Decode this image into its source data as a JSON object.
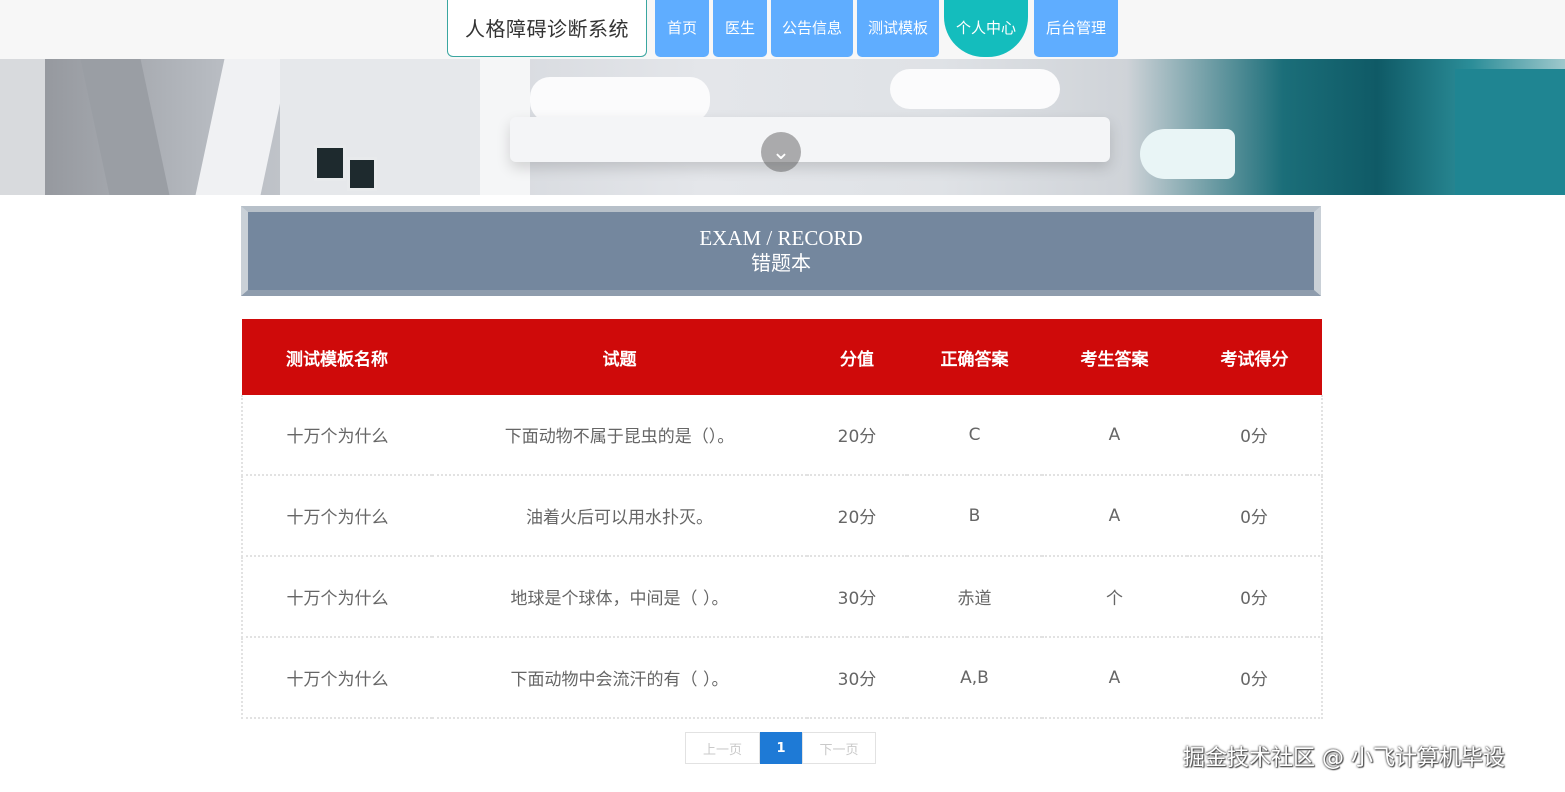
{
  "nav": {
    "site_title": "人格障碍诊断系统",
    "items": [
      {
        "label": "首页",
        "active": false
      },
      {
        "label": "医生",
        "active": false
      },
      {
        "label": "公告信息",
        "active": false
      },
      {
        "label": "测试模板",
        "active": false
      },
      {
        "label": "个人中心",
        "active": true
      },
      {
        "label": "后台管理",
        "active": false
      }
    ]
  },
  "banner": {
    "scroll_icon": "chevron-down-icon"
  },
  "page_title": {
    "en": "EXAM / RECORD",
    "zh": "错题本"
  },
  "table": {
    "headers": [
      "测试模板名称",
      "试题",
      "分值",
      "正确答案",
      "考生答案",
      "考试得分"
    ],
    "rows": [
      [
        "十万个为什么",
        "下面动物不属于昆虫的是（）。",
        "20分",
        "C",
        "A",
        "0分"
      ],
      [
        "十万个为什么",
        "油着火后可以用水扑灭。",
        "20分",
        "B",
        "A",
        "0分"
      ],
      [
        "十万个为什么",
        "地球是个球体，中间是（ ）。",
        "30分",
        "赤道",
        "个",
        "0分"
      ],
      [
        "十万个为什么",
        "下面动物中会流汗的有（ ）。",
        "30分",
        "A,B",
        "A",
        "0分"
      ]
    ]
  },
  "pagination": {
    "prev": "上一页",
    "current": "1",
    "next": "下一页"
  },
  "watermark": "掘金技术社区 @ 小飞计算机毕设",
  "colors": {
    "nav_button": "#5fadff",
    "nav_active": "#14bdbd",
    "table_header": "#cf0a0a",
    "title_card": "#74879e",
    "pager_current": "#1e7ad6"
  }
}
